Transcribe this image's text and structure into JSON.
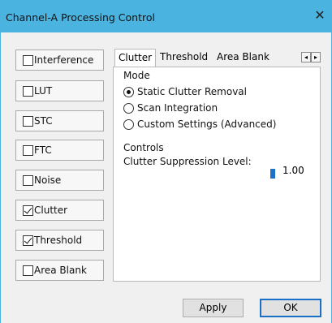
{
  "window": {
    "title": "Channel-A Processing Control",
    "close_glyph": "✕"
  },
  "left_checkboxes": [
    {
      "label": "Interference",
      "checked": false
    },
    {
      "label": "LUT",
      "checked": false
    },
    {
      "label": "STC",
      "checked": false
    },
    {
      "label": "FTC",
      "checked": false
    },
    {
      "label": "Noise",
      "checked": false
    },
    {
      "label": "Clutter",
      "checked": true
    },
    {
      "label": "Threshold",
      "checked": true
    },
    {
      "label": "Area Blank",
      "checked": false
    }
  ],
  "tabs": [
    {
      "label": "Clutter",
      "active": true
    },
    {
      "label": "Threshold",
      "active": false
    },
    {
      "label": "Area Blank",
      "active": false
    }
  ],
  "tab_scroll": {
    "left": "◂",
    "right": "▸"
  },
  "mode": {
    "label": "Mode",
    "options": [
      {
        "label": "Static Clutter Removal",
        "selected": true
      },
      {
        "label": "Scan Integration",
        "selected": false
      },
      {
        "label": "Custom Settings (Advanced)",
        "selected": false
      }
    ]
  },
  "controls": {
    "label": "Controls",
    "suppression_label": "Clutter Suppression Level:",
    "suppression_value": "1.00"
  },
  "buttons": {
    "apply": "Apply",
    "ok": "OK"
  },
  "colors": {
    "titlebar": "#4bb3e0",
    "slider_thumb": "#1c72c6",
    "default_button_border": "#1a6fc7"
  }
}
